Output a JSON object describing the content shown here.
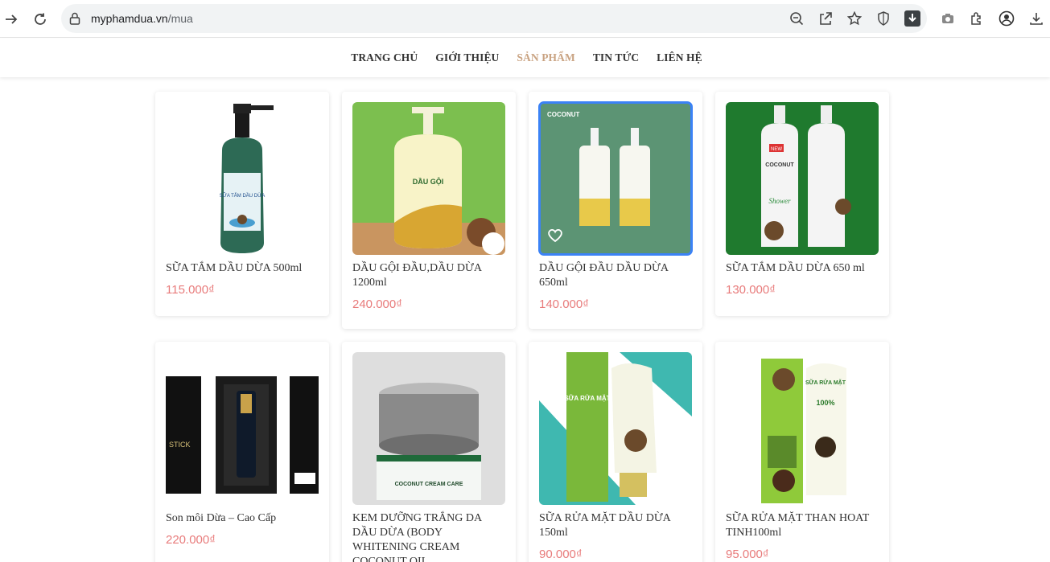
{
  "browser": {
    "url_host": "myphamdua.vn",
    "url_path": "/mua"
  },
  "nav": {
    "items": [
      {
        "label": "TRANG CHỦ",
        "active": false
      },
      {
        "label": "GIỚI THIỆU",
        "active": false
      },
      {
        "label": "SẢN PHẨM",
        "active": true
      },
      {
        "label": "TIN TỨC",
        "active": false
      },
      {
        "label": "LIÊN HỆ",
        "active": false
      }
    ]
  },
  "products": [
    {
      "name": "SỮA TẮM DẦU DỪA 500ml",
      "price": "115.000₫"
    },
    {
      "name": "DẦU GỘI ĐẦU,DẦU DỪA 1200ml",
      "price": "240.000₫"
    },
    {
      "name": "DẦU GỘI ĐẦU DẦU DỪA 650ml",
      "price": "140.000₫"
    },
    {
      "name": "SỮA TẮM DẦU DỪA 650 ml",
      "price": "130.000₫"
    },
    {
      "name": "Son môi Dừa – Cao Cấp",
      "price": "220.000₫"
    },
    {
      "name": "KEM DƯỠNG TRẮNG DA DẦU DỪA (BODY WHITENING CREAM COCONUT OIL",
      "price": ""
    },
    {
      "name": "SỮA RỬA MẶT DẦU DỪA 150ml",
      "price": "90.000₫"
    },
    {
      "name": "SỮA RỬA MẶT THAN HOAT TINH100ml",
      "price": "95.000₫"
    }
  ],
  "image_text": {
    "coconut_brand": "COCONUT",
    "dau_goi": "DẦU GỘI",
    "sua_tam": "SỮA TẮM DẦU DỪA",
    "sua_rua_mat": "SỮA RỬA MẶT",
    "lipstick": "STICK",
    "cream": "COCONUT CREAM CARE",
    "shower": "Shower",
    "new_badge": "NEW",
    "percent": "100%"
  },
  "colors": {
    "accent_nav": "#c9a382",
    "price": "#e87b7b",
    "selected_outline": "#3b82f6"
  }
}
